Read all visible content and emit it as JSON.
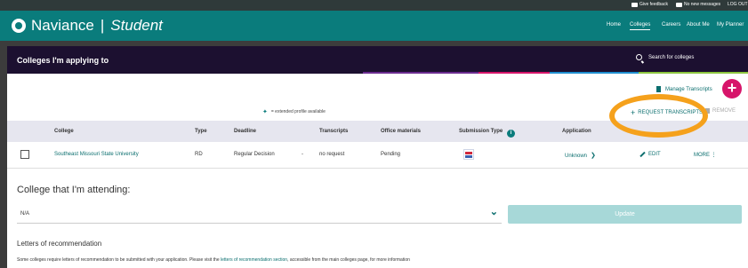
{
  "topbar": {
    "give_feedback": "Give feedback",
    "messages": "No new messages",
    "logout": "LOG OUT"
  },
  "header": {
    "brand": "Naviance",
    "separator": "|",
    "product": "Student",
    "nav": [
      "Home",
      "Colleges",
      "Careers",
      "About Me",
      "My Planner"
    ],
    "active_nav": "Colleges",
    "color": "#0a7c7c"
  },
  "panel": {
    "title": "Colleges I'm applying to",
    "search_label": "Search for colleges",
    "accent_colors": [
      "#6a2c8f",
      "#d7156a",
      "#1f8fd0",
      "#8cc63f"
    ]
  },
  "actions": {
    "manage_transcripts": "Manage Transcripts",
    "add_icon": "+",
    "legend_star": "✦",
    "legend_text": "= extended profile available",
    "request_transcripts": "REQUEST TRANSCRIPTS",
    "remove": "REMOVE"
  },
  "table": {
    "headers": [
      "College",
      "Type",
      "Deadline",
      "Transcripts",
      "Office materials",
      "Submission Type",
      "Application"
    ],
    "rows": [
      {
        "college": "Southeast Missouri State University",
        "type": "RD",
        "deadline": "Regular Decision",
        "deadline_extra": "-",
        "transcripts": "no request",
        "office_materials": "Pending",
        "application": "Unknown",
        "edit": "EDIT",
        "more": "MORE"
      }
    ]
  },
  "attending": {
    "title": "College that I'm attending:",
    "selected": "N/A",
    "update_label": "Update"
  },
  "letters": {
    "title": "Letters of recommendation",
    "text_before": "Some colleges require letters of recommendation to be submitted with your application. Please visit the ",
    "link": "letters of recommendation section",
    "text_after": ", accessible from the main colleges page, for more information"
  },
  "colors": {
    "teal": "#0a7c7c",
    "panel_header": "#1c1030",
    "plus_button": "#d7156a",
    "highlight_ring": "#f5a11c"
  }
}
